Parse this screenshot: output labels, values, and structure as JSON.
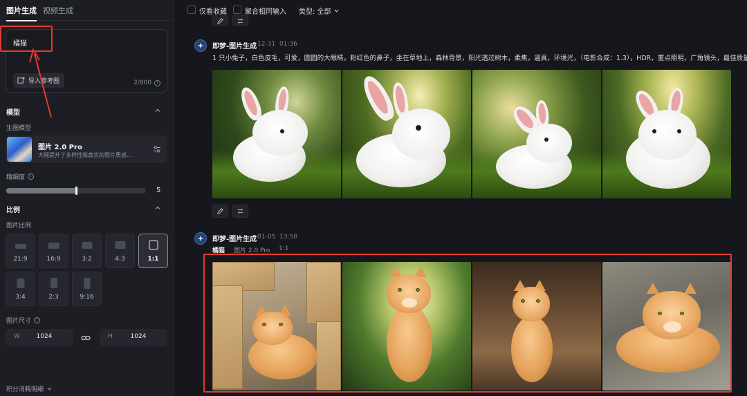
{
  "sidebar": {
    "tabs": [
      {
        "label": "图片生成",
        "active": true
      },
      {
        "label": "视频生成",
        "active": false
      }
    ],
    "prompt": {
      "value": "橘猫",
      "count": "2/800"
    },
    "upload_label": "导入参考图",
    "model_section": {
      "title": "模型",
      "label": "生图模型",
      "model_name": "图片 2.0 Pro",
      "model_desc": "大幅提升了多样性和真实的照片质感..."
    },
    "precision": {
      "label": "精细度",
      "value": "5",
      "level": 0.5
    },
    "ratio_section": {
      "title": "比例",
      "label": "图片比例",
      "options": [
        {
          "label": "21:9",
          "active": false
        },
        {
          "label": "16:9",
          "active": false
        },
        {
          "label": "3:2",
          "active": false
        },
        {
          "label": "4:3",
          "active": false
        },
        {
          "label": "1:1",
          "active": true
        },
        {
          "label": "3:4",
          "active": false
        },
        {
          "label": "2:3",
          "active": false
        },
        {
          "label": "9:16",
          "active": false
        }
      ]
    },
    "size": {
      "label": "图片尺寸",
      "w_axis": "W",
      "w_value": "1024",
      "h_axis": "H",
      "h_value": "1024"
    },
    "credits_label": "积分消耗明细"
  },
  "main": {
    "toolbar": {
      "favorites_label": "仅看收藏",
      "merge_label": "聚合相同输入",
      "type_filter": "类型: 全部"
    },
    "generations": [
      {
        "title": "即梦-图片生成",
        "date": "12-31",
        "time": "01:36",
        "prompt": "1 只小兔子，白色皮毛，可爱，圆圆的大眼睛，粉红色的鼻子，坐在草地上，森林背景，阳光透过树木，柔焦，逼真，环境光，（电影合成：1.3），HDR，重点照明，广角镜头，最佳质量，"
      },
      {
        "title": "即梦-图片生成",
        "date": "01-05",
        "time": "13:58",
        "prompt": "橘猫",
        "model": "图片 2.0 Pro",
        "ratio": "1:1"
      }
    ]
  },
  "colors": {
    "highlight": "#e53935",
    "background": "#16171c",
    "sidebar": "#1d1e24"
  }
}
